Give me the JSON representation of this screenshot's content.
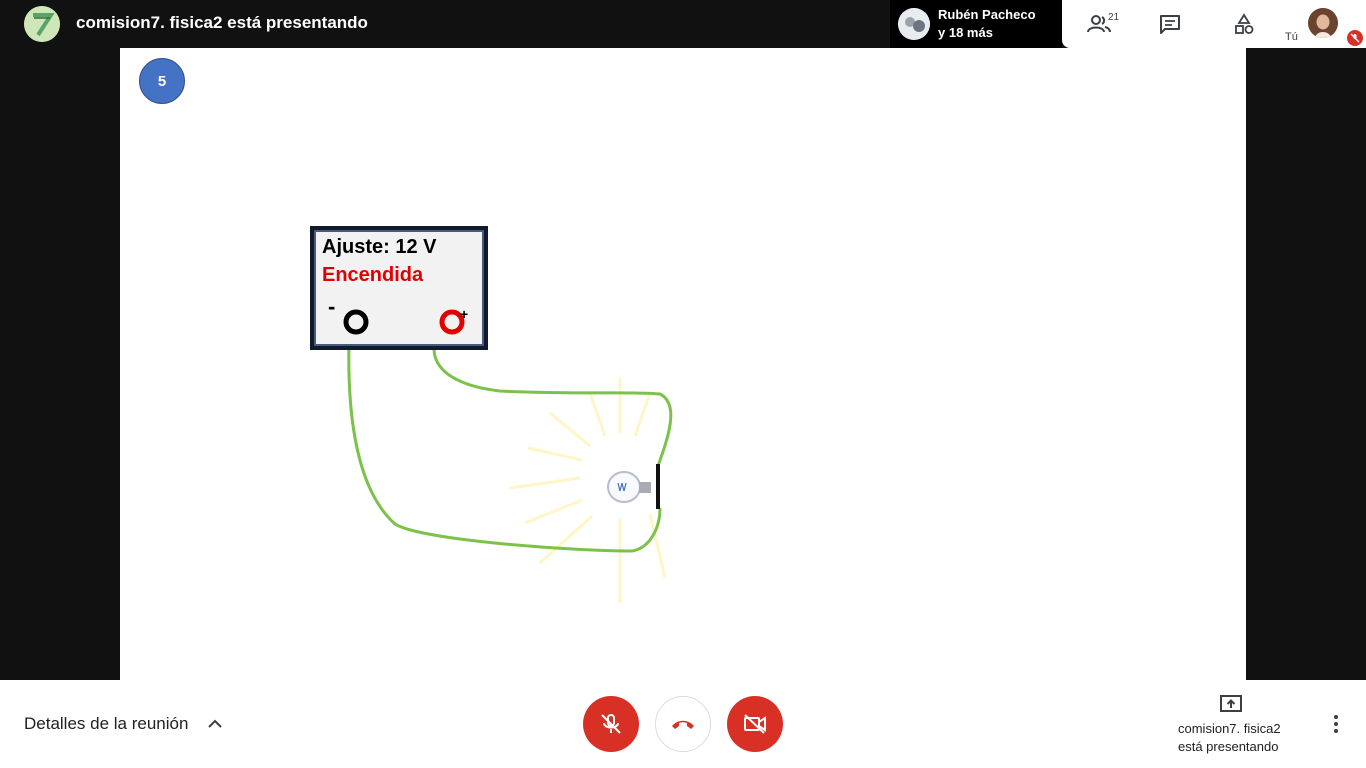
{
  "topbar": {
    "title": "comision7. fisica2 está presentando",
    "others": {
      "name": "Rubén Pacheco",
      "more": "y 18 más"
    },
    "participants_count": "21",
    "self_label": "Tú"
  },
  "slide": {
    "step_number": "5",
    "power_supply": {
      "setting": "Ajuste: 12 V",
      "status": "Encendida",
      "minus": "-",
      "plus": "+"
    }
  },
  "bottombar": {
    "meeting_details": "Detalles de la reunión",
    "presenting_line1": "comision7. fisica2",
    "presenting_line2": "está presentando"
  },
  "colors": {
    "hangup": "#d93025",
    "wire": "#7cc24a",
    "psu_status": "#e00000",
    "step_badge": "#4472c4"
  }
}
